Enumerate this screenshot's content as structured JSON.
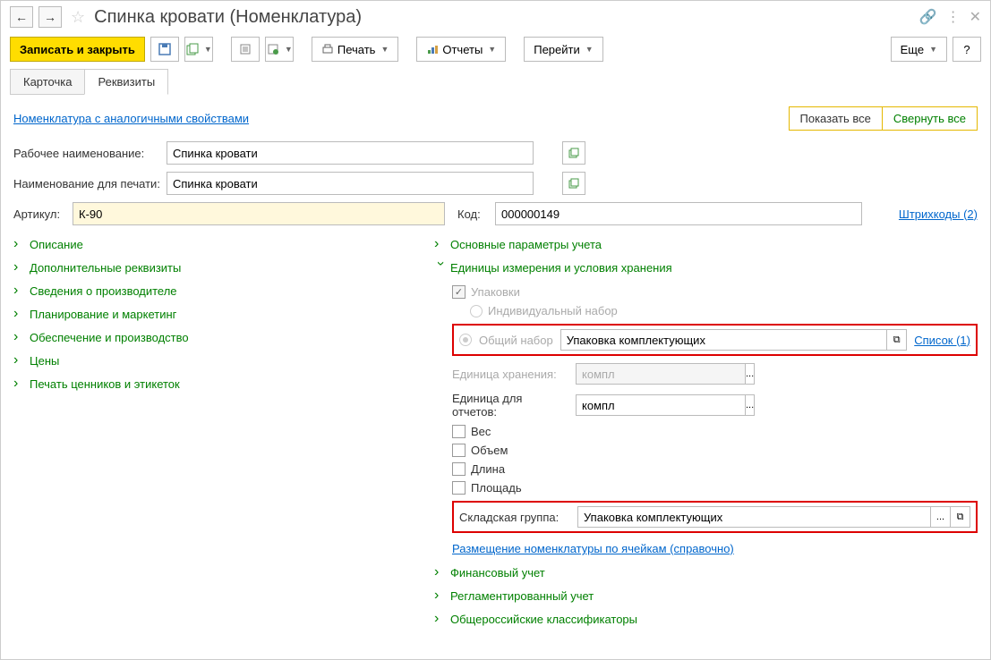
{
  "title": "Спинка кровати (Номенклатура)",
  "toolbar": {
    "save_close": "Записать и закрыть",
    "print": "Печать",
    "reports": "Отчеты",
    "goto": "Перейти",
    "more": "Еще",
    "help": "?"
  },
  "tabs": {
    "card": "Карточка",
    "requisites": "Реквизиты"
  },
  "links": {
    "similar": "Номенклатура с аналогичными свойствами",
    "show_all": "Показать все",
    "collapse_all": "Свернуть все",
    "barcodes": "Штрихкоды (2)",
    "list": "Список (1)",
    "placement": "Размещение номенклатуры по ячейкам (справочно)"
  },
  "fields": {
    "work_name_label": "Рабочее наименование:",
    "work_name_value": "Спинка кровати",
    "print_name_label": "Наименование для печати:",
    "print_name_value": "Спинка кровати",
    "article_label": "Артикул:",
    "article_value": "К-90",
    "code_label": "Код:",
    "code_value": "000000149"
  },
  "tree_left": [
    "Описание",
    "Дополнительные реквизиты",
    "Сведения о производителе",
    "Планирование и маркетинг",
    "Обеспечение и производство",
    "Цены",
    "Печать ценников и этикеток"
  ],
  "tree_right": {
    "main_params": "Основные параметры учета",
    "units": "Единицы измерения и условия хранения",
    "financial": "Финансовый учет",
    "regulated": "Регламентированный учет",
    "classifiers": "Общероссийские классификаторы"
  },
  "units_section": {
    "packages": "Упаковки",
    "individual": "Индивидуальный набор",
    "common": "Общий набор",
    "common_value": "Упаковка комплектующих",
    "storage_unit_label": "Единица хранения:",
    "storage_unit_value": "компл",
    "report_unit_label": "Единица для отчетов:",
    "report_unit_value": "компл",
    "weight": "Вес",
    "volume": "Объем",
    "length": "Длина",
    "area": "Площадь",
    "warehouse_group_label": "Складская группа:",
    "warehouse_group_value": "Упаковка комплектующих"
  }
}
